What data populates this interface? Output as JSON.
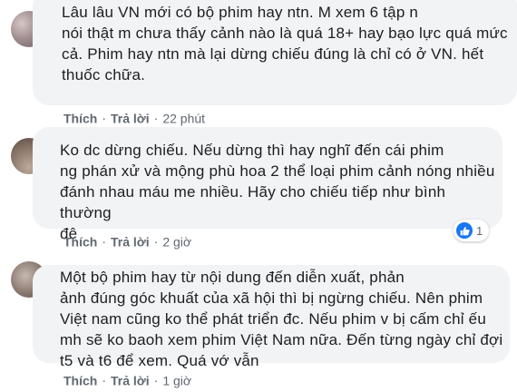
{
  "comments": [
    {
      "text": "Lâu lâu VN mới có bộ phim hay ntn. M xem 6 tập n\nnói thật m chưa thấy cảnh nào là quá 18+ hay bạo lực quá mức\ncả. Phim hay ntn mà lại dừng chiếu đúng là chỉ có ở VN. hết\nthuốc chữa.",
      "like_label": "Thích",
      "reply_label": "Trả lời",
      "time": "22 phút"
    },
    {
      "text": "Ko dc dừng chiếu. Nếu dừng thì hay nghĩ đến cái phim\nng phán xử và mộng phù hoa 2 thể loại phim cảnh nóng nhiều\nđánh nhau máu me nhiều. Hãy cho chiếu tiếp như bình thường\nđê",
      "like_label": "Thích",
      "reply_label": "Trả lời",
      "time": "2 giờ",
      "reaction_count": "1"
    },
    {
      "text": "Một bộ phim hay từ nội dung đến diễn xuất, phản\nảnh đúng góc khuất của xã hội thì bị ngừng chiếu. Nên phim\nViệt nam cũng ko thể phát triển đc. Nếu phim v bị cấm chỉ ếu\nmh sẽ ko baoh xem phim Việt Nam nữa. Đến từng ngày chỉ đợi\nt5 và t6 để xem. Quá vớ vẫn",
      "like_label": "Thích",
      "reply_label": "Trả lời",
      "time": "1 giờ"
    }
  ],
  "separator": "·",
  "colors": {
    "bubble": "#f2f3f5",
    "text": "#1c1e21",
    "meta": "#606770",
    "like_blue": "#1877f2"
  },
  "icons": {
    "reaction": "thumbs-up-icon"
  }
}
